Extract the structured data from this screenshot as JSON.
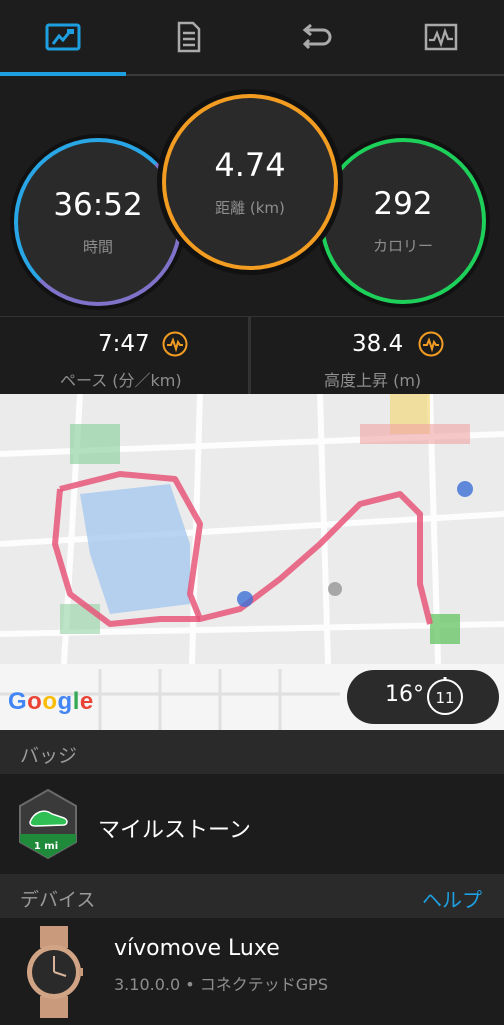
{
  "tabs": [
    {
      "id": "overview",
      "icon": "map-flag-icon",
      "active": true
    },
    {
      "id": "details",
      "icon": "document-list-icon",
      "active": false
    },
    {
      "id": "laps",
      "icon": "loop-arrows-icon",
      "active": false
    },
    {
      "id": "charts",
      "icon": "chart-pulse-icon",
      "active": false
    }
  ],
  "summary": {
    "time": {
      "value": "36:52",
      "label": "時間"
    },
    "distance": {
      "value": "4.74",
      "label": "距離 (km)"
    },
    "calories": {
      "value": "292",
      "label": "カロリー"
    }
  },
  "stats": {
    "pace": {
      "value": "7:47",
      "label": "ペース (分／km)",
      "icon": "performance-wave-icon"
    },
    "elevation": {
      "value": "38.4",
      "label": "高度上昇 (m)",
      "icon": "performance-wave-icon"
    }
  },
  "map": {
    "logo": "Google",
    "weather": {
      "temp": "16°",
      "wind": "11"
    }
  },
  "badges": {
    "section_title": "バッジ",
    "item": {
      "title": "マイルストーン",
      "badge_text": "1 mi"
    }
  },
  "devices": {
    "section_title": "デバイス",
    "help_label": "ヘルプ",
    "item": {
      "name": "vívomove Luxe",
      "detail": "3.10.0.0 • コネクテッドGPS"
    }
  },
  "colors": {
    "accent": "#1e9fe0",
    "distance_ring": "#f29c22",
    "calorie_ring": "#1dd05a",
    "time_ring": "#7e72c9",
    "route": "#e8577a"
  }
}
